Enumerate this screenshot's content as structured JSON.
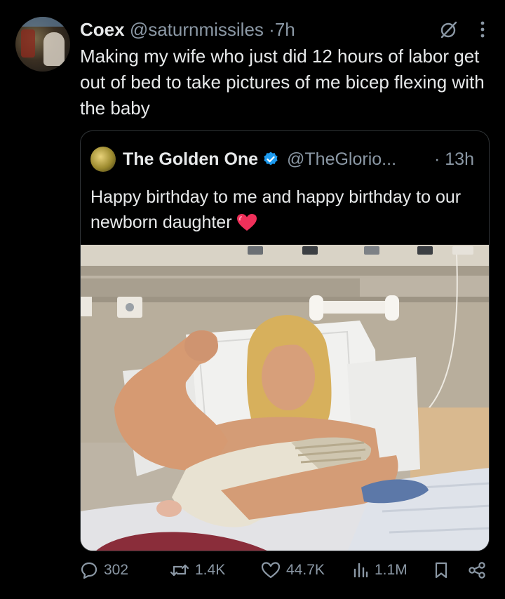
{
  "tweet": {
    "author_name": "Coex",
    "author_handle": "@saturnmissiles",
    "separator": "·",
    "time": "7h",
    "text": "Making my wife who just did 12 hours of labor get out of bed to take pictures of me bicep flexing with the baby",
    "header_icons": [
      "grok-icon",
      "more-icon"
    ]
  },
  "quoted": {
    "author_name": "The Golden One",
    "verified": true,
    "author_handle": "@TheGlorio...",
    "separator": "·",
    "time": "13h",
    "text": "Happy birthday to me and happy birthday to our newborn daughter",
    "emoji": "red-heart"
  },
  "actions": {
    "replies": "302",
    "reposts": "1.4K",
    "likes": "44.7K",
    "views": "1.1M"
  },
  "colors": {
    "background": "#000000",
    "text_primary": "#e7e9ea",
    "text_secondary": "#8b98a5",
    "border": "#2f3336",
    "verified_blue": "#1d9bf0"
  }
}
